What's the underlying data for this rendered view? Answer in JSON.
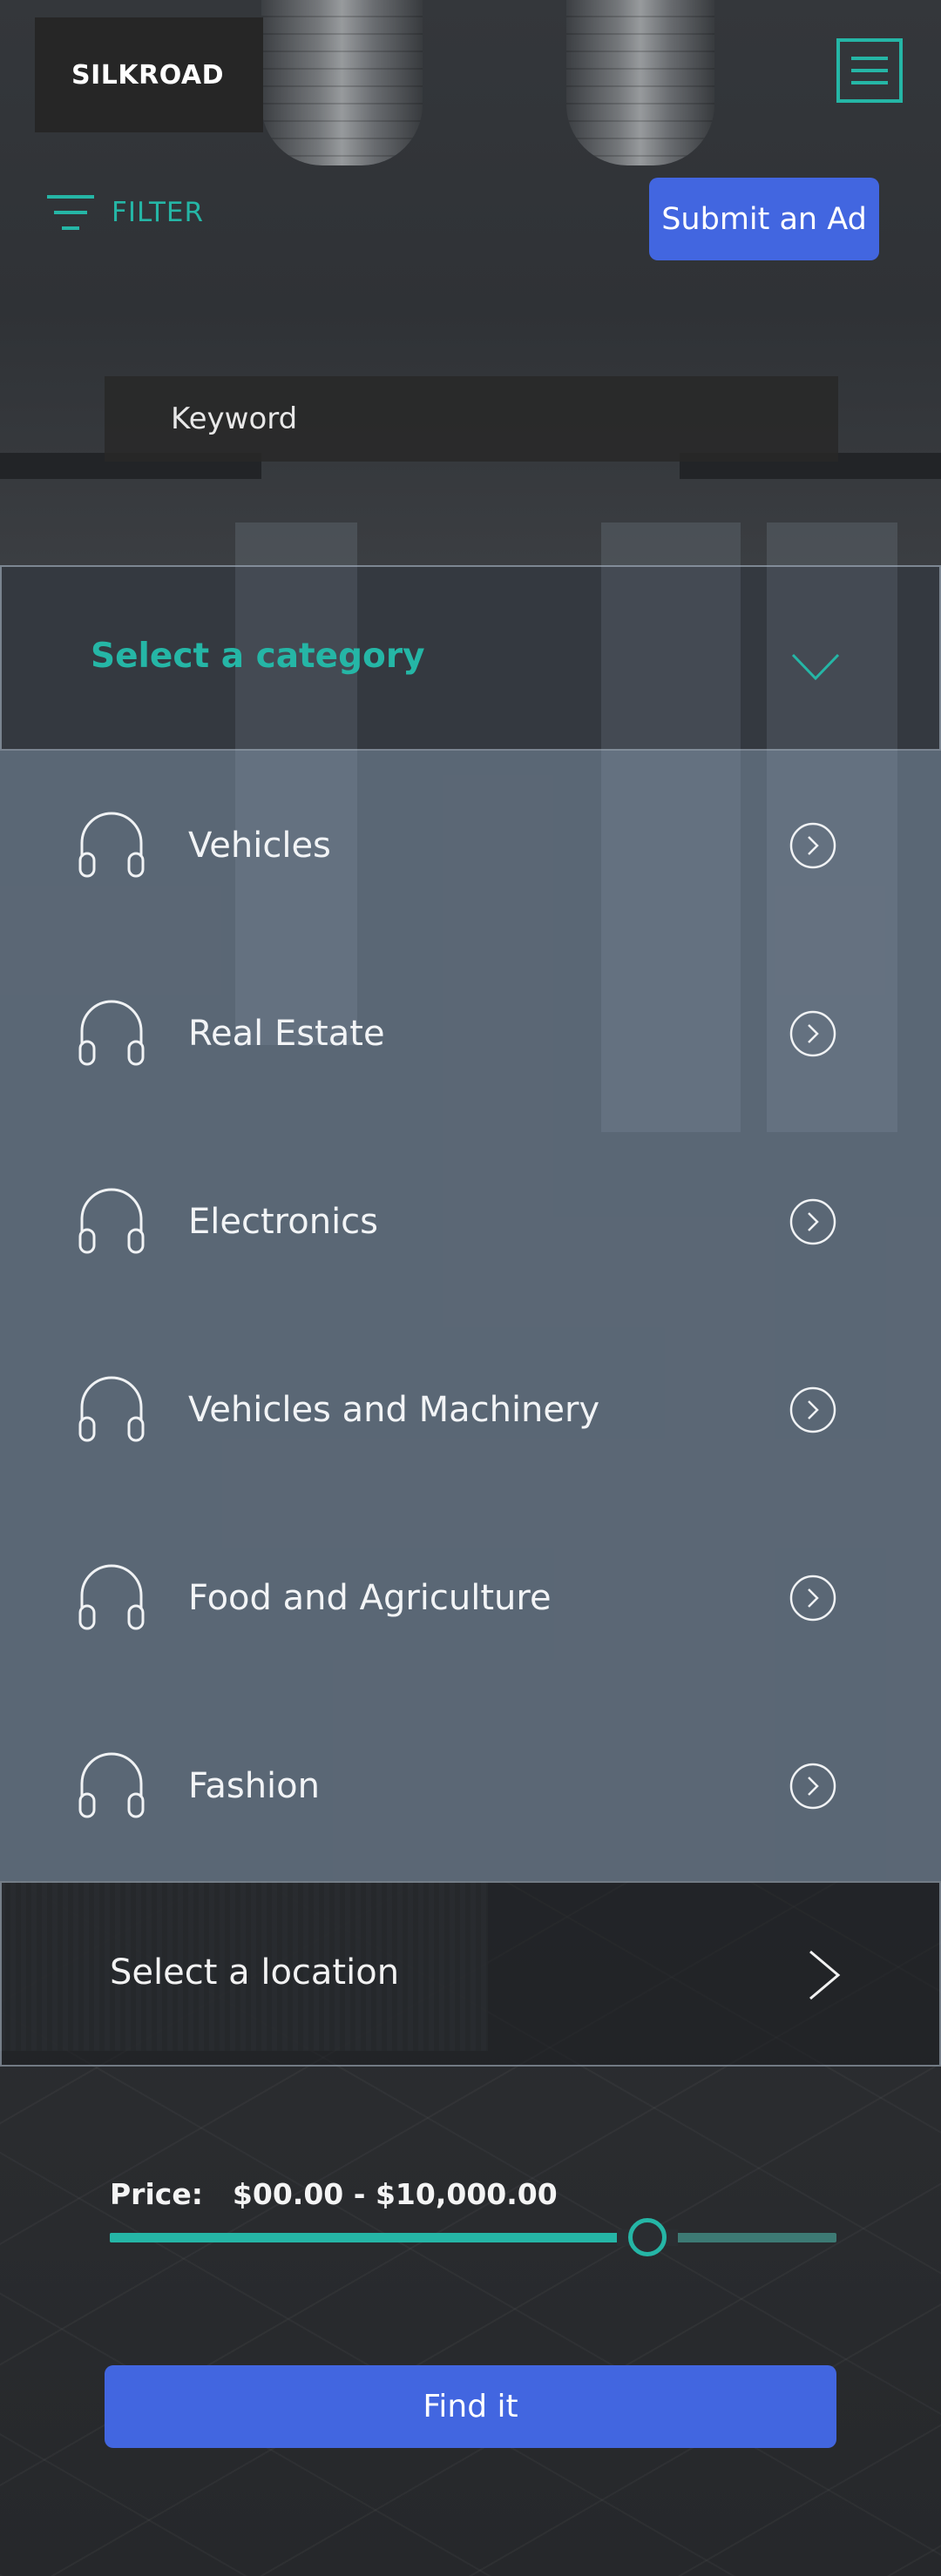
{
  "header": {
    "logo": "SILKROAD",
    "menu_icon": "hamburger-menu-icon",
    "filter_label": "FILTER",
    "filter_icon": "filter-icon",
    "submit_label": "Submit an Ad"
  },
  "search": {
    "keyword_placeholder": "Keyword"
  },
  "category": {
    "title": "Select a category",
    "expanded": true,
    "items": [
      {
        "label": "Vehicles",
        "icon": "headphones-icon"
      },
      {
        "label": "Real Estate",
        "icon": "headphones-icon"
      },
      {
        "label": "Electronics",
        "icon": "headphones-icon"
      },
      {
        "label": "Vehicles and Machinery",
        "icon": "headphones-icon"
      },
      {
        "label": "Food and Agriculture",
        "icon": "headphones-icon"
      },
      {
        "label": "Fashion",
        "icon": "headphones-icon"
      }
    ]
  },
  "location": {
    "label": "Select a location"
  },
  "price": {
    "label": "Price:",
    "range_text": "$00.00 - $10,000.00",
    "slider_fraction": 0.74
  },
  "actions": {
    "find_label": "Find it"
  },
  "colors": {
    "accent": "#25b6a6",
    "button": "#4266e0"
  }
}
